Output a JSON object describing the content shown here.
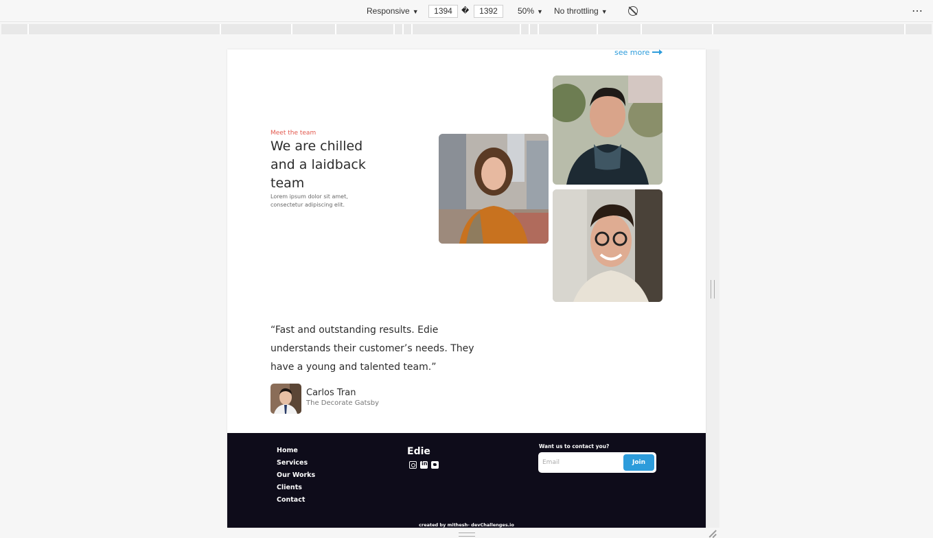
{
  "devtools": {
    "device": "Responsive",
    "width": "1394",
    "height": "1392",
    "times_glyph": "�",
    "zoom": "50%",
    "throttling": "No throttling",
    "more": "⋯"
  },
  "page": {
    "see_more": "see more",
    "team": {
      "eyebrow": "Meet the team",
      "heading": "We are chilled and a laidback team",
      "description": "Lorem ipsum dolor sit amet, consectetur adipiscing elit."
    },
    "testimonial": {
      "quote": "“Fast and outstanding results. Edie understands their customer’s needs. They have a young and talented team.”",
      "author": "Carlos Tran",
      "company": "The Decorate Gatsby"
    },
    "footer": {
      "nav": [
        "Home",
        "Services",
        "Our Works",
        "Clients",
        "Contact"
      ],
      "brand": "Edie",
      "contact_label": "Want us to contact you?",
      "email_placeholder": "Email",
      "join_label": "Join",
      "credit": "created by mithesh- devChallenges.io"
    }
  },
  "colors": {
    "accent": "#2d9cdb",
    "eyebrow": "#e2584d",
    "footer_bg": "#0e0c1a"
  }
}
